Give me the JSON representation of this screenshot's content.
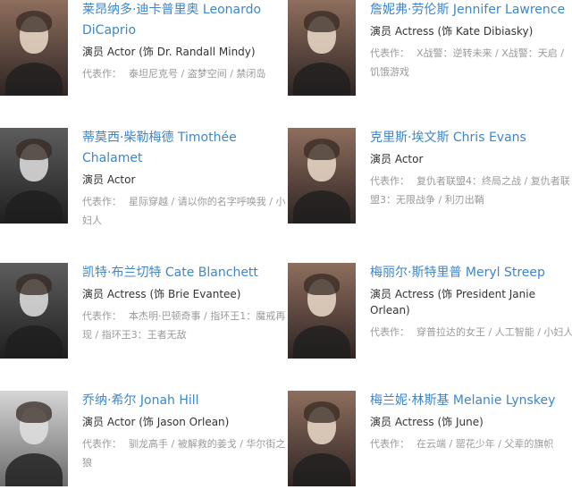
{
  "cast": [
    {
      "name": "莱昂纳多·迪卡普里奥 Leonardo DiCaprio",
      "role": "演员 Actor (饰 Dr. Randall Mindy)",
      "works_label": "代表作：",
      "works": "泰坦尼克号 / 盗梦空间 / 禁闭岛",
      "photo_style": "color"
    },
    {
      "name": "詹妮弗·劳伦斯 Jennifer Lawrence",
      "role": "演员 Actress (饰 Kate Dibiasky)",
      "works_label": "代表作：",
      "works": "X战警：逆转未来 / X战警：天启 / 饥饿游戏",
      "photo_style": "color"
    },
    {
      "name": "蒂莫西·柴勒梅德 Timothée Chalamet",
      "role": "演员 Actor",
      "works_label": "代表作：",
      "works": "星际穿越 / 请以你的名字呼唤我 / 小妇人",
      "photo_style": "bw"
    },
    {
      "name": "克里斯·埃文斯 Chris Evans",
      "role": "演员 Actor",
      "works_label": "代表作：",
      "works": "复仇者联盟4：终局之战 / 复仇者联盟3：无限战争 / 利刃出鞘",
      "photo_style": "color"
    },
    {
      "name": "凯特·布兰切特 Cate Blanchett",
      "role": "演员 Actress (饰 Brie Evantee)",
      "works_label": "代表作：",
      "works": "本杰明·巴顿奇事 / 指环王1：魔戒再现 / 指环王3：王者无敌",
      "photo_style": "bw"
    },
    {
      "name": "梅丽尔·斯特里普 Meryl Streep",
      "role": "演员 Actress (饰 President Janie Orlean)",
      "works_label": "代表作：",
      "works": "穿普拉达的女王 / 人工智能 / 小妇人",
      "photo_style": "color"
    },
    {
      "name": "乔纳·希尔 Jonah Hill",
      "role": "演员 Actor (饰 Jason Orlean)",
      "works_label": "代表作：",
      "works": "驯龙高手 / 被解救的姜戈 / 华尔街之狼",
      "photo_style": "light"
    },
    {
      "name": "梅兰妮·林斯基 Melanie Lynskey",
      "role": "演员 Actress (饰 June)",
      "works_label": "代表作：",
      "works": "在云端 / 罂花少年 / 父辈的旗帜",
      "photo_style": "color"
    }
  ]
}
